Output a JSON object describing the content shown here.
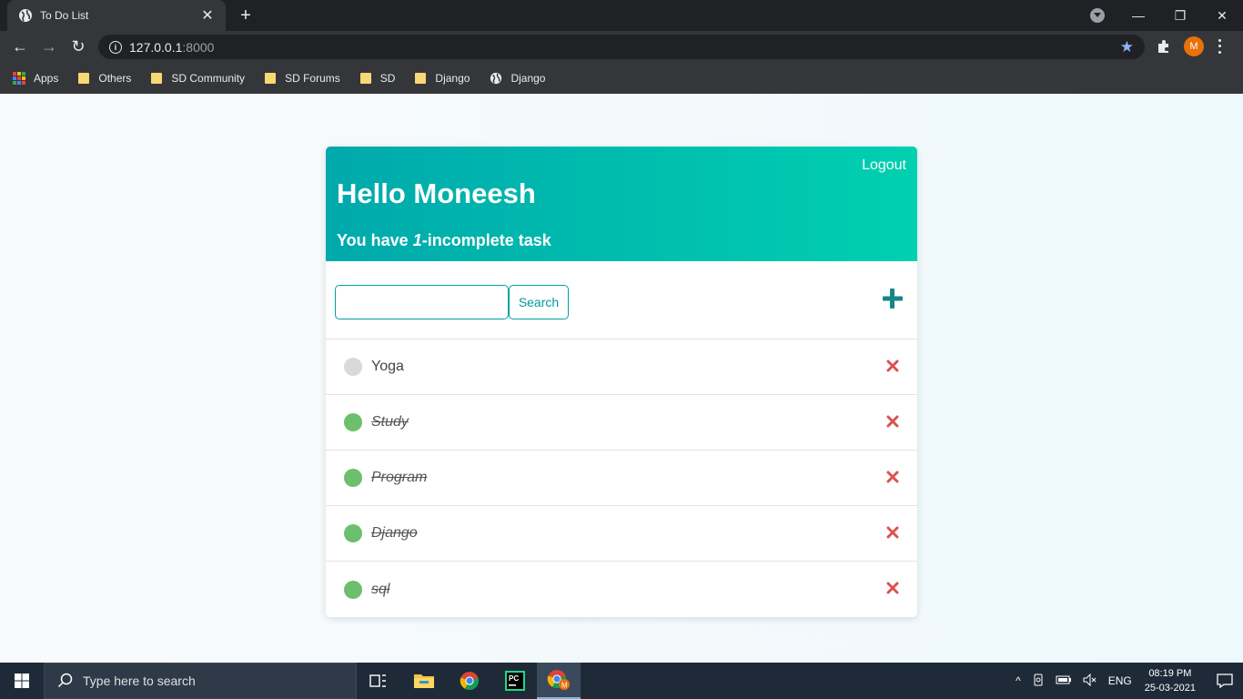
{
  "browser": {
    "tab_title": "To Do List",
    "address_host": "127.0.0.1",
    "address_port": ":8000",
    "profile_initial": "M",
    "bookmarks": [
      {
        "label": "Apps",
        "icon": "apps-grid-icon"
      },
      {
        "label": "Others",
        "icon": "folder-icon"
      },
      {
        "label": "SD Community",
        "icon": "folder-icon"
      },
      {
        "label": "SD Forums",
        "icon": "folder-icon"
      },
      {
        "label": "SD",
        "icon": "folder-icon"
      },
      {
        "label": "Django",
        "icon": "folder-icon"
      },
      {
        "label": "Django",
        "icon": "globe-icon"
      }
    ]
  },
  "app": {
    "logout_label": "Logout",
    "greeting": "Hello Moneesh",
    "subtitle_prefix": "You have ",
    "incomplete_count": "1",
    "subtitle_suffix": "-incomplete task",
    "search_value": "",
    "search_button": "Search",
    "tasks": [
      {
        "title": "Yoga",
        "complete": false
      },
      {
        "title": "Study",
        "complete": true
      },
      {
        "title": "Program",
        "complete": true
      },
      {
        "title": "Django",
        "complete": true
      },
      {
        "title": "sql",
        "complete": true
      }
    ],
    "colors": {
      "header_start": "#00a9ac",
      "header_end": "#00d0b0",
      "complete_dot": "#5cb85c",
      "incomplete_dot": "#d9d9d9",
      "delete": "#d9534f",
      "add": "#17868a"
    }
  },
  "taskbar": {
    "search_placeholder": "Type here to search",
    "language": "ENG",
    "time": "08:19 PM",
    "date": "25-03-2021"
  }
}
